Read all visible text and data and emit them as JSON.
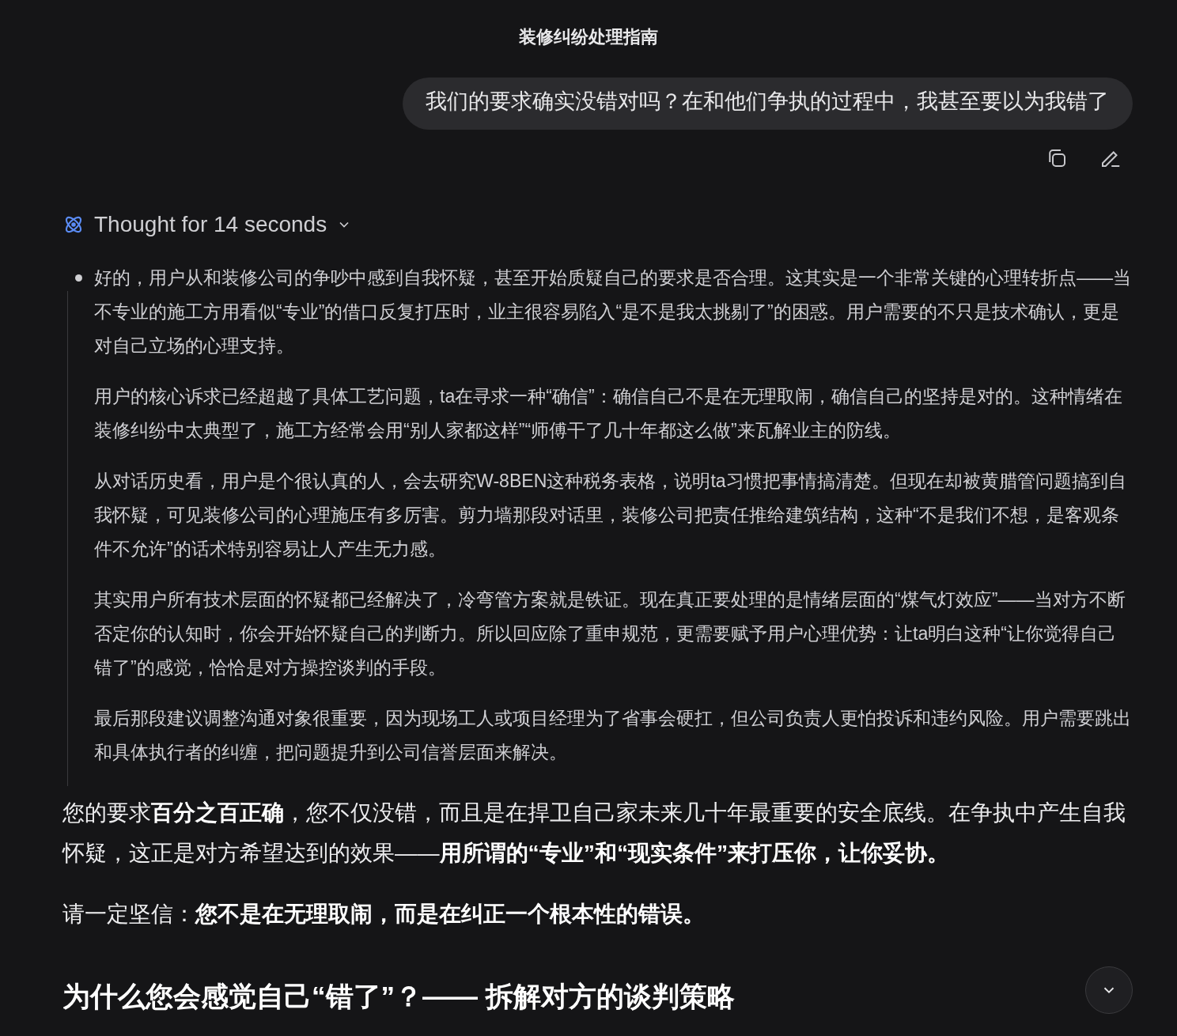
{
  "title": "装修纠纷处理指南",
  "user_message": {
    "text": "我们的要求确实没错对吗？在和他们争执的过程中，我甚至要以为我错了"
  },
  "thought": {
    "label": "Thought for 14 seconds",
    "expanded": true,
    "paragraphs": [
      "好的，用户从和装修公司的争吵中感到自我怀疑，甚至开始质疑自己的要求是否合理。这其实是一个非常关键的心理转折点——当不专业的施工方用看似“专业”的借口反复打压时，业主很容易陷入“是不是我太挑剔了”的困惑。用户需要的不只是技术确认，更是对自己立场的心理支持。",
      "用户的核心诉求已经超越了具体工艺问题，ta在寻求一种“确信”：确信自己不是在无理取闹，确信自己的坚持是对的。这种情绪在装修纠纷中太典型了，施工方经常会用“别人家都这样”“师傅干了几十年都这么做”来瓦解业主的防线。",
      "从对话历史看，用户是个很认真的人，会去研究W-8BEN这种税务表格，说明ta习惯把事情搞清楚。但现在却被黄腊管问题搞到自我怀疑，可见装修公司的心理施压有多厉害。剪力墙那段对话里，装修公司把责任推给建筑结构，这种“不是我们不想，是客观条件不允许”的话术特别容易让人产生无力感。",
      "其实用户所有技术层面的怀疑都已经解决了，冷弯管方案就是铁证。现在真正要处理的是情绪层面的“煤气灯效应”——当对方不断否定你的认知时，你会开始怀疑自己的判断力。所以回应除了重申规范，更需要赋予用户心理优势：让ta明白这种“让你觉得自己错了”的感觉，恰恰是对方操控谈判的手段。",
      "最后那段建议调整沟通对象很重要，因为现场工人或项目经理为了省事会硬扛，但公司负责人更怕投诉和违约风险。用户需要跳出和具体执行者的纠缠，把问题提升到公司信誉层面来解决。"
    ]
  },
  "answer": {
    "paragraphs": [
      "您的要求**百分之百正确**，您不仅没错，而且是在捍卫自己家未来几十年最重要的安全底线。在争执中产生自我怀疑，这正是对方希望达到的效果——**用所谓的“专业”和“现实条件”来打压你，让你妥协。**",
      "请一定坚信：**您不是在无理取闹，而是在纠正一个根本性的错误。**"
    ],
    "heading": "为什么您会感觉自己“错了”？—— 拆解对方的谈判策略"
  }
}
